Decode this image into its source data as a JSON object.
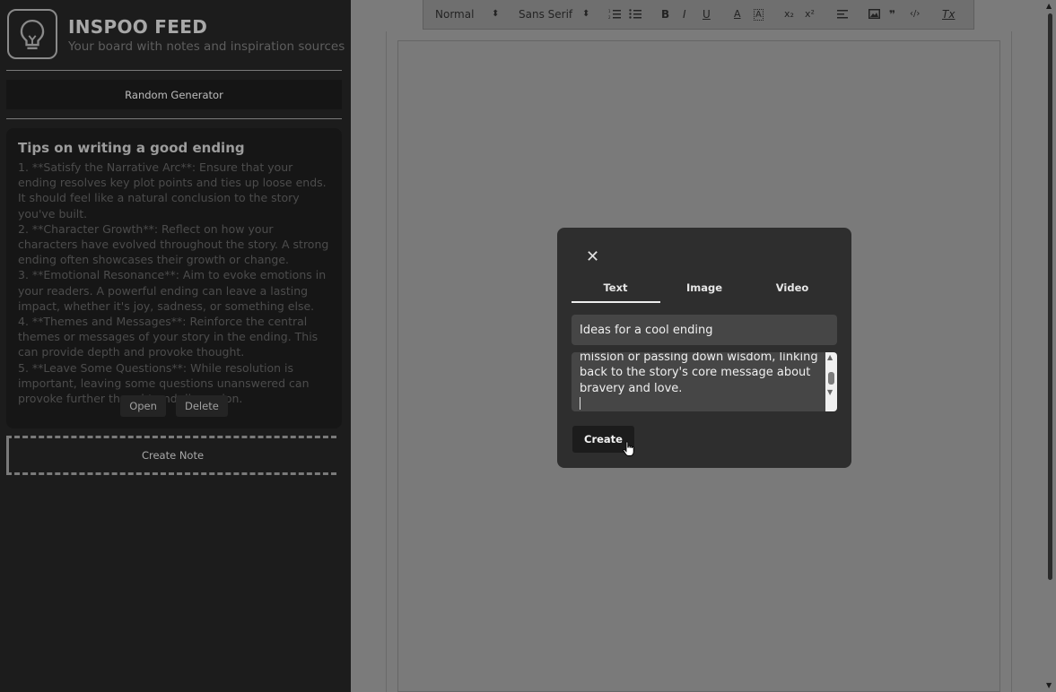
{
  "app": {
    "title": "INSPOO FEED",
    "subtitle": "Your board with notes and inspiration sources"
  },
  "sidebar": {
    "random_label": "Random Generator",
    "create_note_label": "Create Note"
  },
  "note": {
    "title": "Tips on writing a good ending",
    "body": "1. **Satisfy the Narrative Arc**: Ensure that your ending resolves key plot points and ties up loose ends. It should feel like a natural conclusion to the story you've built.\n2. **Character Growth**: Reflect on how your characters have evolved throughout the story. A strong ending often showcases their growth or change.\n3. **Emotional Resonance**: Aim to evoke emotions in your readers. A powerful ending can leave a lasting impact, whether it's joy, sadness, or something else.\n4. **Themes and Messages**: Reinforce the central themes or messages of your story in the ending. This can provide depth and provoke thought.\n5. **Leave Some Questions**: While resolution is important, leaving some questions unanswered can provoke further thought and discussion.",
    "open_label": "Open",
    "delete_label": "Delete"
  },
  "toolbar": {
    "heading_select": "Normal",
    "font_select": "Sans Serif",
    "select_arrow": "⬍",
    "bold": "B",
    "italic": "I",
    "underline": "U",
    "color": "A",
    "background": "A",
    "subscript": "x₂",
    "superscript": "x²",
    "quote": "❞",
    "code": "‹/›",
    "clean": "Tx"
  },
  "modal": {
    "close": "✕",
    "tabs": [
      "Text",
      "Image",
      "Video"
    ],
    "active_tab": "Text",
    "title_value": "Ideas for a cool ending",
    "textarea_value": "mission or passing down wisdom, linking back to the story's core message about bravery and love.",
    "create_label": "Create"
  },
  "icons": {
    "logo": "lightbulb-icon",
    "close": "close-icon",
    "cursor": "hand-pointer-icon"
  },
  "colors": {
    "sidebar_bg": "#1c1c1c",
    "overlay_bg": "#7b7b7b",
    "modal_bg": "#2e2e2e"
  }
}
